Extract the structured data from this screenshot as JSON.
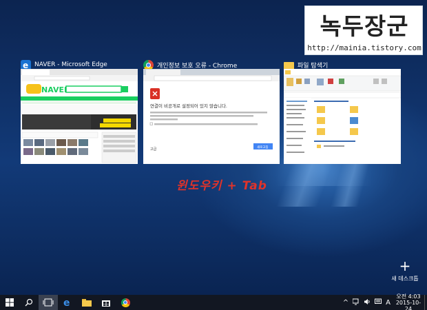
{
  "watermark": {
    "title": "녹두장군",
    "url": "http://mainia.tistory.com"
  },
  "windows": [
    {
      "title": "NAVER - Microsoft Edge",
      "icon": "edge-icon",
      "content": {
        "tab": "NAVER",
        "url": "naver.com",
        "logo": "NAVER",
        "search_btn": "검색",
        "banner": "[아나라] 2015 앙맺은 정맺해\nV Beauty OPEN!"
      }
    },
    {
      "title": "개인정보 보호 오류 - Chrome",
      "icon": "chrome-icon",
      "content": {
        "tab": "개인정보 보호 오류",
        "url": "https://www.google.co.kr/_/chrome/newtab?espv=2&ie=UTF-8",
        "heading": "연결이 비공개로 설정되어 있지 않습니다.",
        "body": "공격자가 www.google.co.kr에서 사용자의 정보를 도용하려고 시도할 수 있습니다(예: 비밀번호, 메시지, 신용카드).",
        "checkbox": "발생 가능성이 있는 보안 문제의 세부정보를 자동으로 Google에 보고합니다. 개인정보 보호정책",
        "advanced": "고급",
        "reload": "새로고침"
      }
    },
    {
      "title": "파일 탐색기",
      "icon": "folder-icon",
      "content": {
        "quick": "자주 사용하는 폴더 (6)",
        "recent": "최근에 사용한 파일 (20)",
        "file": "Desktop_file.lnk"
      }
    }
  ],
  "annotation": "윈도우키 + Tab",
  "new_desktop": {
    "plus": "+",
    "label": "새 데스크톱"
  },
  "taskbar": {
    "items": [
      "start",
      "search",
      "task-view",
      "edge",
      "explorer",
      "store",
      "chrome"
    ]
  },
  "tray": {
    "caret": "^",
    "ime": "A",
    "time": "오전 4:03",
    "date": "2015-10-24"
  }
}
